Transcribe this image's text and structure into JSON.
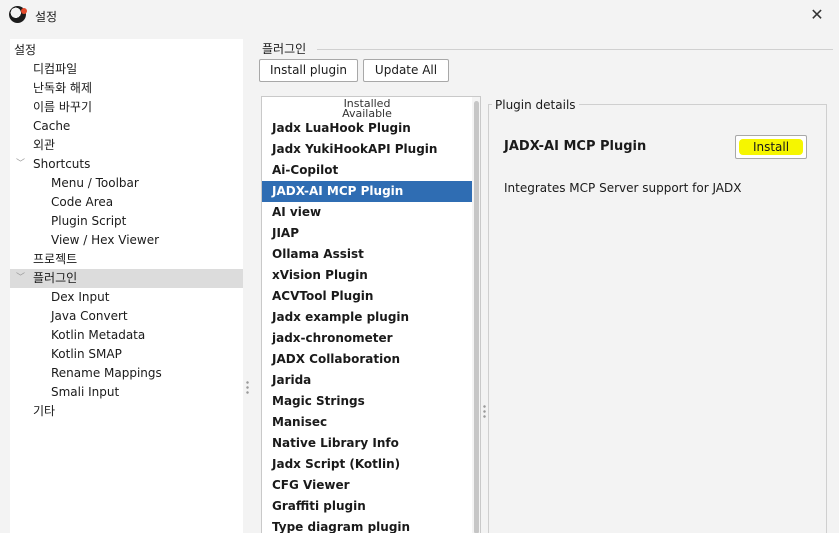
{
  "window": {
    "title": "설정",
    "close_glyph": "✕"
  },
  "tree": [
    {
      "label": "설정",
      "level": 0,
      "expanded": false,
      "selected": false
    },
    {
      "label": "디컴파일",
      "level": 1,
      "selected": false
    },
    {
      "label": "난독화 해제",
      "level": 1,
      "selected": false
    },
    {
      "label": "이름 바꾸기",
      "level": 1,
      "selected": false
    },
    {
      "label": "Cache",
      "level": 1,
      "selected": false
    },
    {
      "label": "외관",
      "level": 1,
      "selected": false
    },
    {
      "label": "Shortcuts",
      "level": 1,
      "expandable": true,
      "selected": false
    },
    {
      "label": "Menu / Toolbar",
      "level": 2,
      "selected": false
    },
    {
      "label": "Code Area",
      "level": 2,
      "selected": false
    },
    {
      "label": "Plugin Script",
      "level": 2,
      "selected": false
    },
    {
      "label": "View / Hex Viewer",
      "level": 2,
      "selected": false
    },
    {
      "label": "프로젝트",
      "level": 1,
      "selected": false
    },
    {
      "label": "플러그인",
      "level": 1,
      "expandable": true,
      "selected": true
    },
    {
      "label": "Dex Input",
      "level": 2,
      "selected": false
    },
    {
      "label": "Java Convert",
      "level": 2,
      "selected": false
    },
    {
      "label": "Kotlin Metadata",
      "level": 2,
      "selected": false
    },
    {
      "label": "Kotlin SMAP",
      "level": 2,
      "selected": false
    },
    {
      "label": "Rename Mappings",
      "level": 2,
      "selected": false
    },
    {
      "label": "Smali Input",
      "level": 2,
      "selected": false
    },
    {
      "label": "기타",
      "level": 1,
      "selected": false
    }
  ],
  "plugins": {
    "section_title": "플러그인",
    "install_plugin_label": "Install plugin",
    "update_all_label": "Update All",
    "list_headers": [
      "Installed",
      "Available"
    ],
    "items": [
      "Jadx LuaHook Plugin",
      "Jadx YukiHookAPI Plugin",
      "Ai-Copilot",
      "JADX-AI MCP Plugin",
      "AI view",
      "JIAP",
      "Ollama Assist",
      "xVision Plugin",
      "ACVTool Plugin",
      "Jadx example plugin",
      "jadx-chronometer",
      "JADX Collaboration",
      "Jarida",
      "Magic Strings",
      "Manisec",
      "Native Library Info",
      "Jadx Script (Kotlin)",
      "CFG Viewer",
      "Graffiti plugin",
      "Type diagram plugin"
    ],
    "selected_index": 3
  },
  "details": {
    "legend": "Plugin details",
    "name": "JADX-AI MCP Plugin",
    "install_label": "Install",
    "install_highlight_color": "#f6f600",
    "description": "Integrates MCP Server support for JADX"
  },
  "colors": {
    "selection": "#2f6db3",
    "tree_selection": "#dcdcdc"
  }
}
